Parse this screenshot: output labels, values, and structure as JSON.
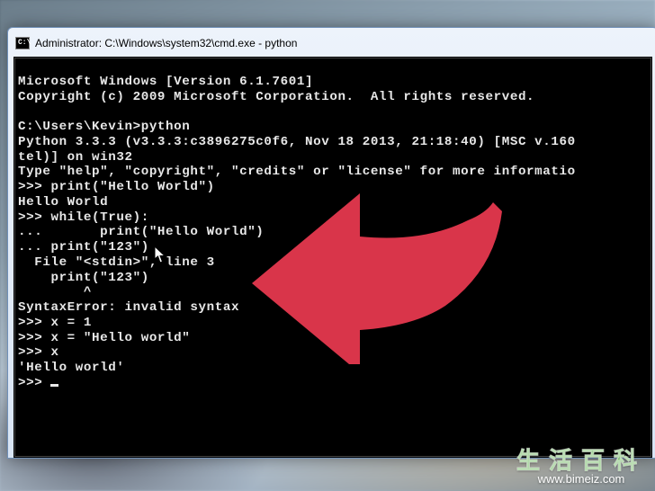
{
  "window": {
    "title": "Administrator: C:\\Windows\\system32\\cmd.exe - python",
    "cmd_icon_text": "C:\\"
  },
  "terminal": {
    "lines": [
      "Microsoft Windows [Version 6.1.7601]",
      "Copyright (c) 2009 Microsoft Corporation.  All rights reserved.",
      "",
      "C:\\Users\\Kevin>python",
      "Python 3.3.3 (v3.3.3:c3896275c0f6, Nov 18 2013, 21:18:40) [MSC v.160",
      "tel)] on win32",
      "Type \"help\", \"copyright\", \"credits\" or \"license\" for more informatio",
      ">>> print(\"Hello World\")",
      "Hello World",
      ">>> while(True):",
      "...       print(\"Hello World\")",
      "... print(\"123\")",
      "  File \"<stdin>\", line 3",
      "    print(\"123\")",
      "        ^",
      "SyntaxError: invalid syntax",
      ">>> x = 1",
      ">>> x = \"Hello world\"",
      ">>> x",
      "'Hello world'",
      ">>> "
    ]
  },
  "watermark": {
    "line1": "生活百科",
    "line2": "www.bimeiz.com"
  }
}
